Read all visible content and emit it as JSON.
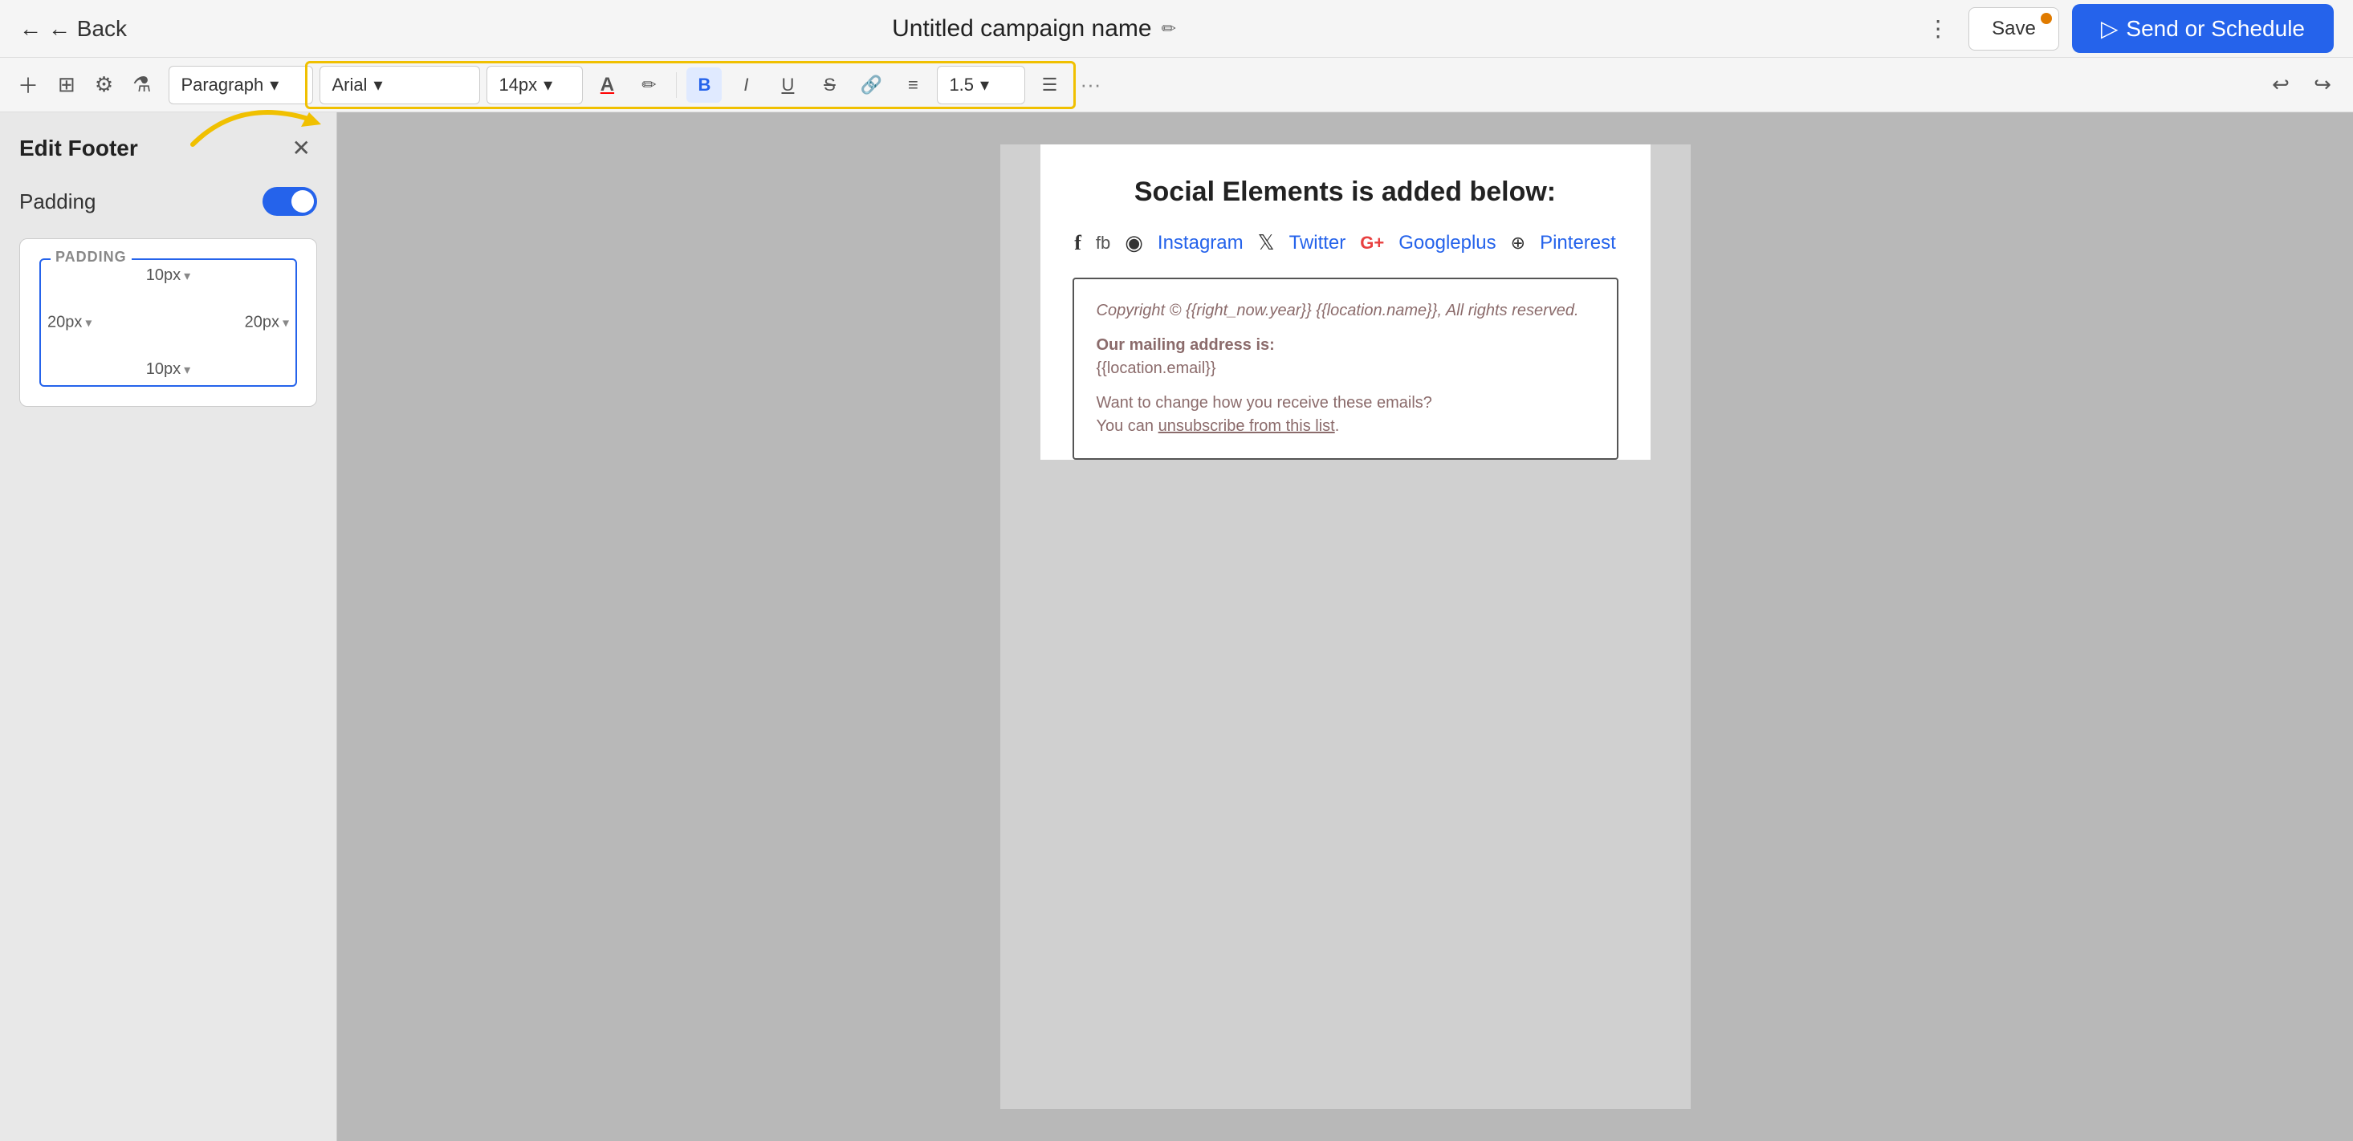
{
  "header": {
    "back_label": "← Back",
    "campaign_name": "Untitled campaign name",
    "edit_icon": "✏",
    "more_icon": "⋮",
    "save_label": "Save",
    "send_label": "Send or Schedule"
  },
  "toolbar": {
    "paragraph_label": "Paragraph",
    "paragraph_chevron": "▾",
    "font_label": "Arial",
    "font_chevron": "▾",
    "size_label": "14px",
    "size_chevron": "▾",
    "font_color_icon": "A",
    "highlight_icon": "✏",
    "bold_label": "B",
    "italic_label": "I",
    "underline_label": "U",
    "strikethrough_label": "S",
    "link_label": "🔗",
    "align_label": "≡",
    "line_height_label": "1.5",
    "line_height_chevron": "▾",
    "list_label": "☰",
    "more_label": "···",
    "undo_label": "↩",
    "redo_label": "↪"
  },
  "sidebar": {
    "title": "Edit Footer",
    "close_icon": "✕",
    "padding_label": "Padding",
    "toggle_on": true,
    "padding_tag": "PADDING",
    "top_padding": "10px",
    "bottom_padding": "10px",
    "left_padding": "20px",
    "right_padding": "20px"
  },
  "canvas": {
    "heading": "Social Elements is added below:",
    "social_items": [
      {
        "icon": "f",
        "type": "icon",
        "label": null
      },
      {
        "icon": "fb",
        "type": "text-icon",
        "label": null
      },
      {
        "icon": "📷",
        "type": "icon",
        "label": null
      },
      {
        "icon": null,
        "type": "link",
        "label": "Instagram"
      },
      {
        "icon": "𝕏",
        "type": "icon",
        "label": null
      },
      {
        "icon": null,
        "type": "link",
        "label": "Twitter"
      },
      {
        "icon": "G+",
        "type": "icon",
        "label": null
      },
      {
        "icon": null,
        "type": "link",
        "label": "Googleplus"
      },
      {
        "icon": "⊕",
        "type": "icon",
        "label": null
      },
      {
        "icon": null,
        "type": "link",
        "label": "Pinterest"
      }
    ],
    "footer": {
      "copyright": "Copyright © {{right_now.year}}  {{location.name}}, All rights reserved.",
      "address_title": "Our mailing address is:",
      "address_email": "{{location.email}}",
      "unsub_line1": "Want to change how you receive these emails?",
      "unsub_line2_prefix": "You can ",
      "unsub_link": "unsubscribe from this list",
      "unsub_suffix": "."
    }
  }
}
